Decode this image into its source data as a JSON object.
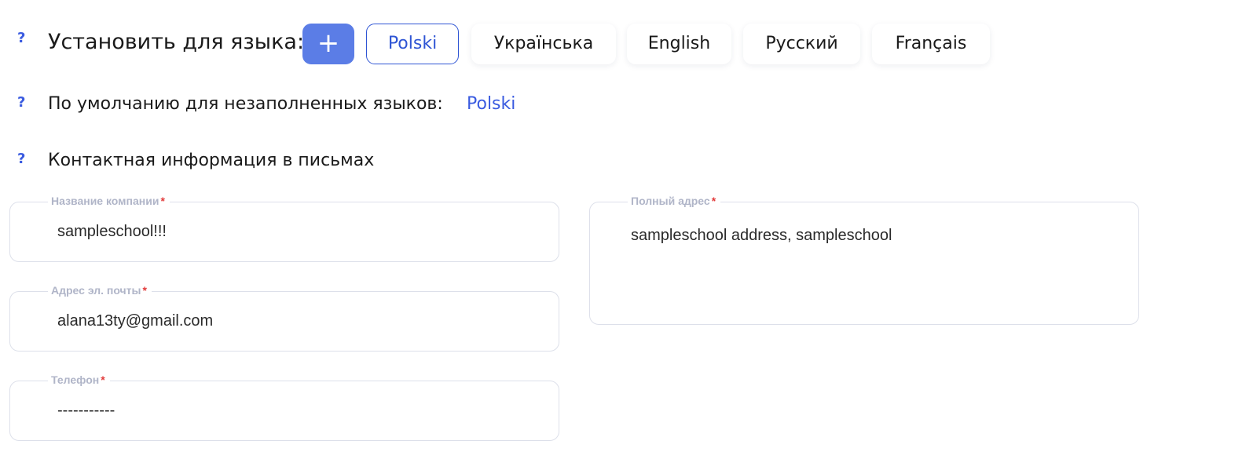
{
  "set_language": {
    "label": "Установить для языка:",
    "add_label": "+",
    "languages": [
      "Polski",
      "Українська",
      "English",
      "Русский",
      "Français"
    ],
    "active_index": 0
  },
  "default_lang": {
    "label": "По умолчанию для незаполненных языков:",
    "value": "Polski"
  },
  "contact": {
    "title": "Контактная информация в письмах",
    "fields": {
      "company": {
        "label": "Название компании",
        "value": "sampleschool!!!"
      },
      "email": {
        "label": "Адрес эл. почты",
        "value": "alana13ty@gmail.com"
      },
      "phone": {
        "label": "Телефон",
        "value": "-----------"
      },
      "address": {
        "label": "Полный адрес",
        "value": "sampleschool address, sampleschool"
      }
    },
    "required_mark": "*"
  },
  "help_mark": "?",
  "colors": {
    "accent": "#3a5be0",
    "add_button": "#5b7de6",
    "required": "#e23b3b",
    "field_border": "#dde0ea",
    "field_label": "#b0b5c8"
  }
}
